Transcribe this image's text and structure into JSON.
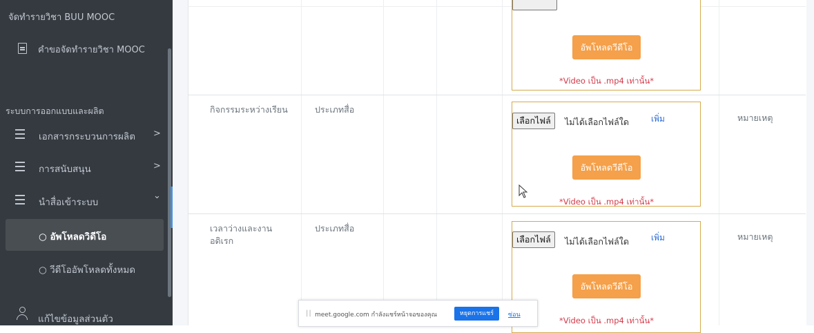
{
  "sidebar": {
    "top_item": "จัดทำรายวิชา BUU MOOC",
    "request_item": "คำขอจัดทำรายวิชา MOOC",
    "section_header": "ระบบการออกแบบและผลิต",
    "menu": [
      {
        "label": "เอกสารกระบวนการผลิต",
        "chevron": ">"
      },
      {
        "label": "การสนับสนุน",
        "chevron": ">"
      },
      {
        "label": "นำสื่อเข้าระบบ",
        "chevron": "⌄"
      }
    ],
    "submenu": [
      {
        "label": "○ อัพโหลดวิดีโอ",
        "active": true
      },
      {
        "label": "○ วีดีโออัพโหลดทั้งหมด",
        "active": false
      }
    ],
    "profile_item": "แก้ไขข้อมูลส่วนตัว"
  },
  "rows": [
    {
      "upload_button": "อัพโหลดวีดีโอ",
      "note": "*Video เป็น .mp4 เท่านั้น*"
    },
    {
      "activity": "กิจกรรมระหว่างเรียน",
      "media_type": "ประเภทสื่อ",
      "choose_file": "เลือกไฟล์",
      "no_file": "ไม่ได้เลือกไฟล์ใด",
      "add": "เพิ่ม",
      "upload_button": "อัพโหลดวีดีโอ",
      "note": "*Video เป็น .mp4 เท่านั้น*",
      "remark": "หมายเหตุ"
    },
    {
      "activity": "เวลาว่างและงานอดิเรก",
      "media_type": "ประเภทสื่อ",
      "choose_file": "เลือกไฟล์",
      "no_file": "ไม่ได้เลือกไฟล์ใด",
      "add": "เพิ่ม",
      "upload_button": "อัพโหลดวีดีโอ",
      "note": "*Video เป็น .mp4 เท่านั้น*",
      "remark": "หมายเหตุ"
    }
  ],
  "share_bar": {
    "message": "meet.google.com กำลังแชร์หน้าจอของคุณ",
    "stop": "หยุดการแชร์",
    "hide": "ซ่อน"
  }
}
